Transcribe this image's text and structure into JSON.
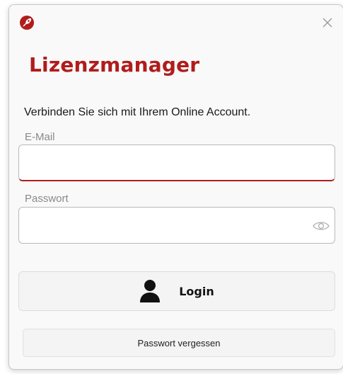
{
  "window": {
    "logo_icon": "rocket-logo-icon",
    "close_icon": "close-icon"
  },
  "title": "Lizenzmanager",
  "subtitle": "Verbinden Sie sich mit Ihrem Online Account.",
  "email": {
    "label": "E-Mail",
    "value": "",
    "placeholder": ""
  },
  "password": {
    "label": "Passwort",
    "value": "",
    "placeholder": "",
    "toggle_icon": "eye-icon"
  },
  "login": {
    "label": "Login",
    "icon": "user-icon"
  },
  "forgot": {
    "label": "Passwort vergessen"
  },
  "colors": {
    "accent": "#b01c1c",
    "text": "#1a1a1a",
    "label": "#8a8a8a",
    "button_bg": "#f4f4f4"
  }
}
